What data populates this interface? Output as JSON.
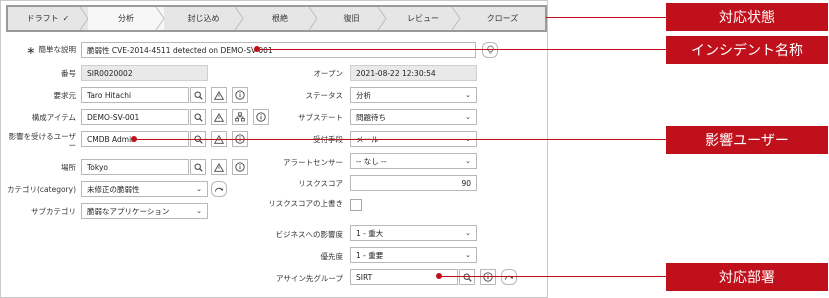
{
  "flow": {
    "stages": [
      {
        "label": "ドラフト",
        "check": "✓"
      },
      {
        "label": "分析"
      },
      {
        "label": "封じ込め"
      },
      {
        "label": "根絶"
      },
      {
        "label": "復旧"
      },
      {
        "label": "レビュー"
      },
      {
        "label": "クローズ"
      }
    ]
  },
  "form": {
    "short_desc": {
      "label": "簡単な説明",
      "value": "脆弱性 CVE-2014-4511 detected on DEMO-SV-001"
    },
    "number": {
      "label": "番号",
      "value": "SIR0020002"
    },
    "opened": {
      "label": "オープン",
      "value": "2021-08-22 12:30:54"
    },
    "requester": {
      "label": "要求元",
      "value": "Taro Hitachi"
    },
    "status": {
      "label": "ステータス",
      "value": "分析"
    },
    "ci": {
      "label": "構成アイテム",
      "value": "DEMO-SV-001"
    },
    "substate": {
      "label": "サブステート",
      "value": "問題待ち"
    },
    "affected_user": {
      "label": "影響を受けるユーザー",
      "value": "CMDB Admin"
    },
    "contact_type": {
      "label": "受付手段",
      "value": "メール"
    },
    "location": {
      "label": "場所",
      "value": "Tokyo"
    },
    "alert_sensor": {
      "label": "アラートセンサー",
      "value": "-- なし --"
    },
    "category": {
      "label": "カテゴリ(category)",
      "value": "未修正の脆弱性"
    },
    "risk_score": {
      "label": "リスクスコア",
      "value": "90"
    },
    "subcategory": {
      "label": "サブカテゴリ",
      "value": "脆弱なアプリケーション"
    },
    "risk_override": {
      "label": "リスクスコアの上書き"
    },
    "business_impact": {
      "label": "ビジネスへの影響度",
      "value": "1 - 重大"
    },
    "priority": {
      "label": "優先度",
      "value": "1 - 重要"
    },
    "assignment_group": {
      "label": "アサイン先グループ",
      "value": "SIRT"
    }
  },
  "callouts": {
    "state": "対応状態",
    "incident_name": "インシデント名称",
    "affected_user": "影響ユーザー",
    "department": "対応部署"
  },
  "colors": {
    "callout": "#c0101b",
    "flow_border": "#9a9a9a",
    "readonly": "#e9e9e9"
  }
}
